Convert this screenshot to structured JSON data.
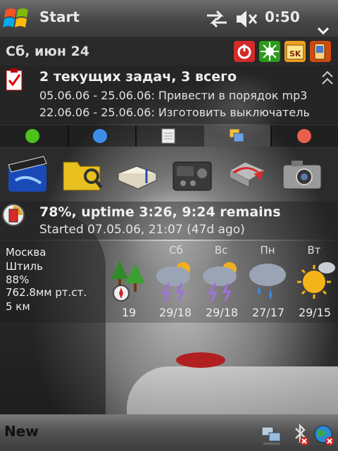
{
  "topbar": {
    "title": "Start",
    "clock": "0:50"
  },
  "today": {
    "date": "Сб, июн 24",
    "tasks": {
      "title": "2 текущих задач, 3 всего",
      "items": [
        "05.06.06 - 25.06.06: Привести в порядок mp3",
        "22.06.06 - 25.06.06: Изготовить выключатель"
      ]
    },
    "battery": {
      "title": "78%, uptime 3:26, 9:24 remains",
      "started": "Started 07.05.06, 21:07 (47d ago)"
    },
    "weather": {
      "city": "Москва",
      "wind": "Штиль",
      "humidity": "88%",
      "pressure": "762.8мм рт.ст.",
      "visibility": "5 км",
      "forecast": [
        {
          "day": "",
          "temp": "19",
          "icon": "forest-compass-icon"
        },
        {
          "day": "Сб",
          "temp": "29/18",
          "icon": "thunderstorm-sun-icon"
        },
        {
          "day": "Вс",
          "temp": "29/18",
          "icon": "thunderstorm-sun-icon"
        },
        {
          "day": "Пн",
          "temp": "27/17",
          "icon": "rain-icon"
        },
        {
          "day": "Вт",
          "temp": "29/15",
          "icon": "sunny-cloud-icon"
        }
      ]
    }
  },
  "softkeys": {
    "left": "New"
  },
  "colors": {
    "power_button": "#e03030",
    "green_dot": "#4cc21a",
    "blue_dot": "#3d8ee8",
    "red_dot": "#e8604d"
  }
}
